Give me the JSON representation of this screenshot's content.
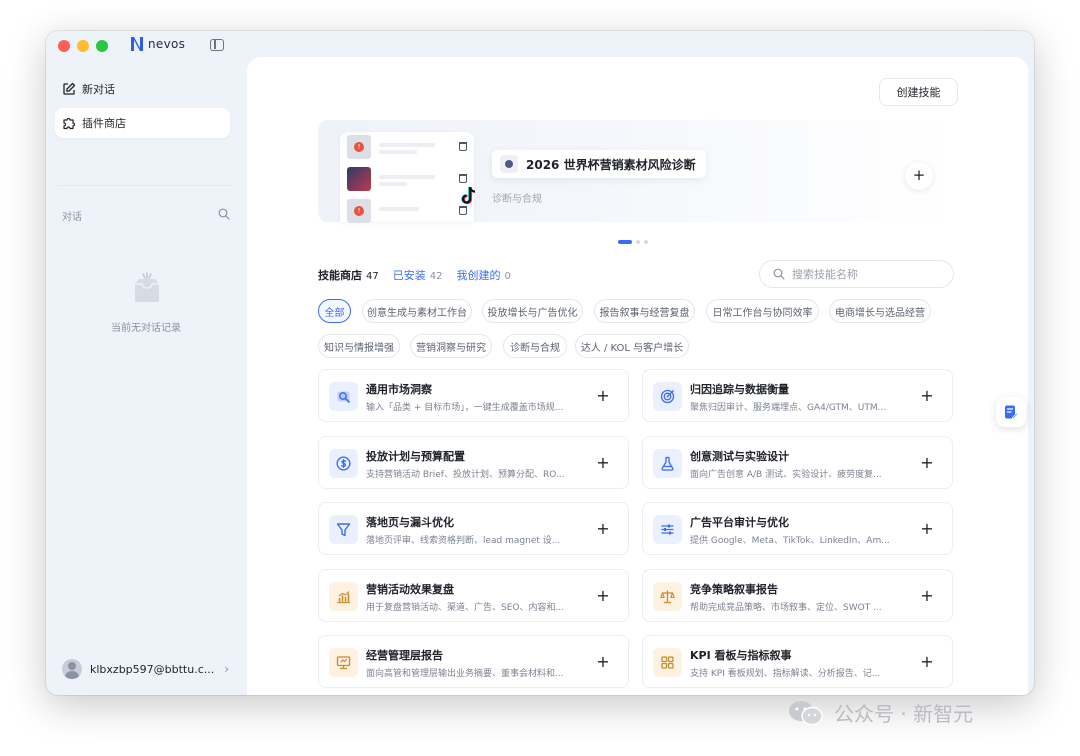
{
  "app": {
    "name": "nevos"
  },
  "sidebar": {
    "new_chat": "新对话",
    "plugin_store": "插件商店",
    "section_title": "对话",
    "empty_text": "当前无对话记录",
    "user_email": "klbxzbp597@bbttu.c...",
    "user_chevron": "›"
  },
  "header": {
    "create_button": "创建技能"
  },
  "banner": {
    "title": "2026 世界杯营销素材风险诊断",
    "subtitle": "诊断与合规",
    "add": "+",
    "alert_glyph": "!",
    "slides": 3,
    "active_slide": 1
  },
  "tabs": [
    {
      "label": "技能商店",
      "count": "47"
    },
    {
      "label": "已安装",
      "count": "42"
    },
    {
      "label": "我创建的",
      "count": "0"
    }
  ],
  "search": {
    "placeholder": "搜索技能名称"
  },
  "filters": [
    "全部",
    "创意生成与素材工作台",
    "投放增长与广告优化",
    "报告叙事与经营复盘",
    "日常工作台与协同效率",
    "电商增长与选品经营",
    "知识与情报增强",
    "营销洞察与研究",
    "诊断与合规",
    "达人 / KOL 与客户增长"
  ],
  "skills": [
    {
      "title": "通用市场洞察",
      "desc": "输入「品类 + 目标市场」，一键生成覆盖市场规...",
      "icon": "market-insight-icon",
      "tone": "blue"
    },
    {
      "title": "归因追踪与数据衡量",
      "desc": "聚焦归因审计、服务端埋点、GA4/GTM、UTM...",
      "icon": "attribution-target-icon",
      "tone": "blue"
    },
    {
      "title": "投放计划与预算配置",
      "desc": "支持营销活动 Brief、投放计划、预算分配、RO...",
      "icon": "budget-coin-icon",
      "tone": "blue"
    },
    {
      "title": "创意测试与实验设计",
      "desc": "面向广告创意 A/B 测试、实验设计、疲劳度复...",
      "icon": "flask-icon",
      "tone": "blue"
    },
    {
      "title": "落地页与漏斗优化",
      "desc": "落地页评审、线索资格判断、lead magnet 设...",
      "icon": "funnel-icon",
      "tone": "blue"
    },
    {
      "title": "广告平台审计与优化",
      "desc": "提供 Google、Meta、TikTok、LinkedIn、Am...",
      "icon": "sliders-icon",
      "tone": "blue"
    },
    {
      "title": "营销活动效果复盘",
      "desc": "用于复盘营销活动、渠道、广告、SEO、内容和...",
      "icon": "bar-chart-icon",
      "tone": "amber"
    },
    {
      "title": "竞争策略叙事报告",
      "desc": "帮助完成竞品策略、市场叙事、定位、SWOT ...",
      "icon": "balance-scale-icon",
      "tone": "amber"
    },
    {
      "title": "经营管理层报告",
      "desc": "面向高管和管理层输出业务摘要、董事会材料和...",
      "icon": "presentation-icon",
      "tone": "amber"
    },
    {
      "title": "KPI 看板与指标叙事",
      "desc": "支持 KPI 看板规划、指标解读、分析报告、记...",
      "icon": "dashboard-grid-icon",
      "tone": "amber"
    }
  ],
  "watermark": {
    "text": "公众号 · 新智元"
  },
  "colors": {
    "accent": "#3b6cf6",
    "sidebar_bg": "#eef2f9",
    "amber_icon": "#c98a2b"
  }
}
